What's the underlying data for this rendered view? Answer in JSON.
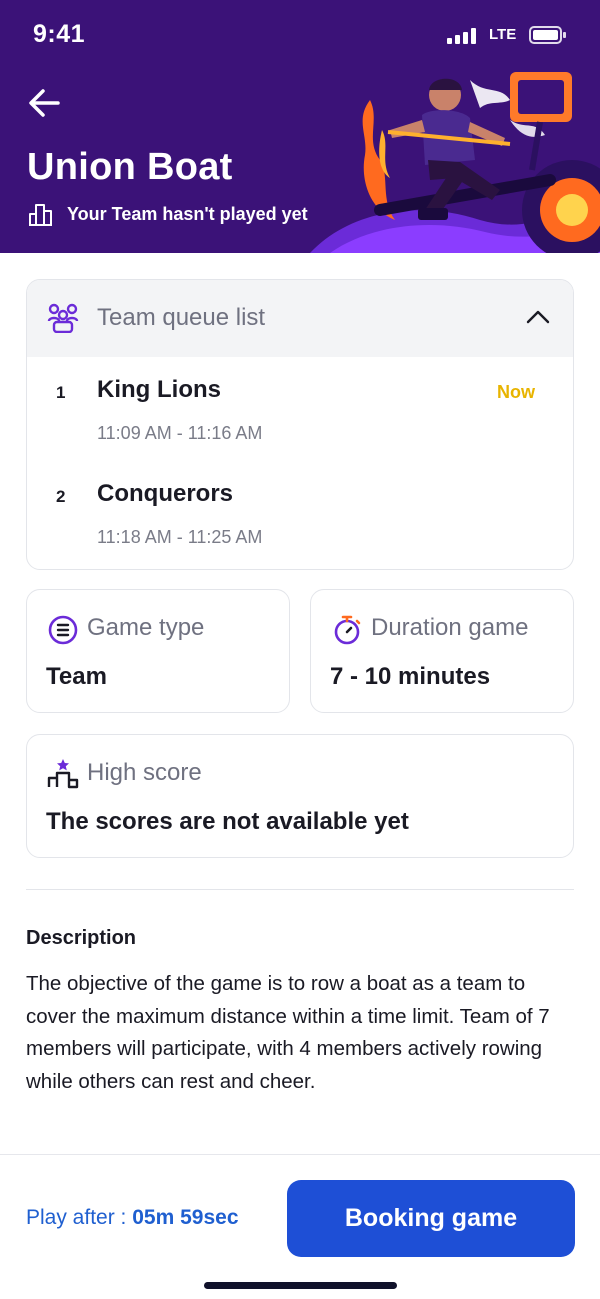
{
  "status_bar": {
    "time": "9:41",
    "network": "LTE"
  },
  "header": {
    "title": "Union Boat",
    "subtitle": "Your Team hasn't played yet",
    "colors": {
      "background": "#3b1278",
      "accent_purple": "#8b3dff",
      "accent_orange": "#ff6a1f"
    }
  },
  "queue": {
    "label": "Team queue list",
    "items": [
      {
        "position": "1",
        "name": "King Lions",
        "time": "11:09 AM - 11:16 AM",
        "status": "Now"
      },
      {
        "position": "2",
        "name": "Conquerors",
        "time": "11:18 AM - 11:25 AM",
        "status": ""
      }
    ]
  },
  "game_type": {
    "label": "Game type",
    "value": "Team"
  },
  "duration": {
    "label": "Duration game",
    "value": "7 - 10 minutes"
  },
  "high_score": {
    "label": "High score",
    "value": "The scores are not available yet"
  },
  "description": {
    "title": "Description",
    "text": "The objective of the game is to row a boat as a team to cover the maximum distance within a time limit. Team of 7 members will participate, with 4 members actively rowing while others can rest and cheer."
  },
  "footer": {
    "play_after_label": "Play after :",
    "countdown": "05m 59sec",
    "book_label": "Booking game",
    "colors": {
      "primary": "#1e4fd6",
      "link": "#1f5fd0",
      "now": "#e8b400"
    }
  }
}
